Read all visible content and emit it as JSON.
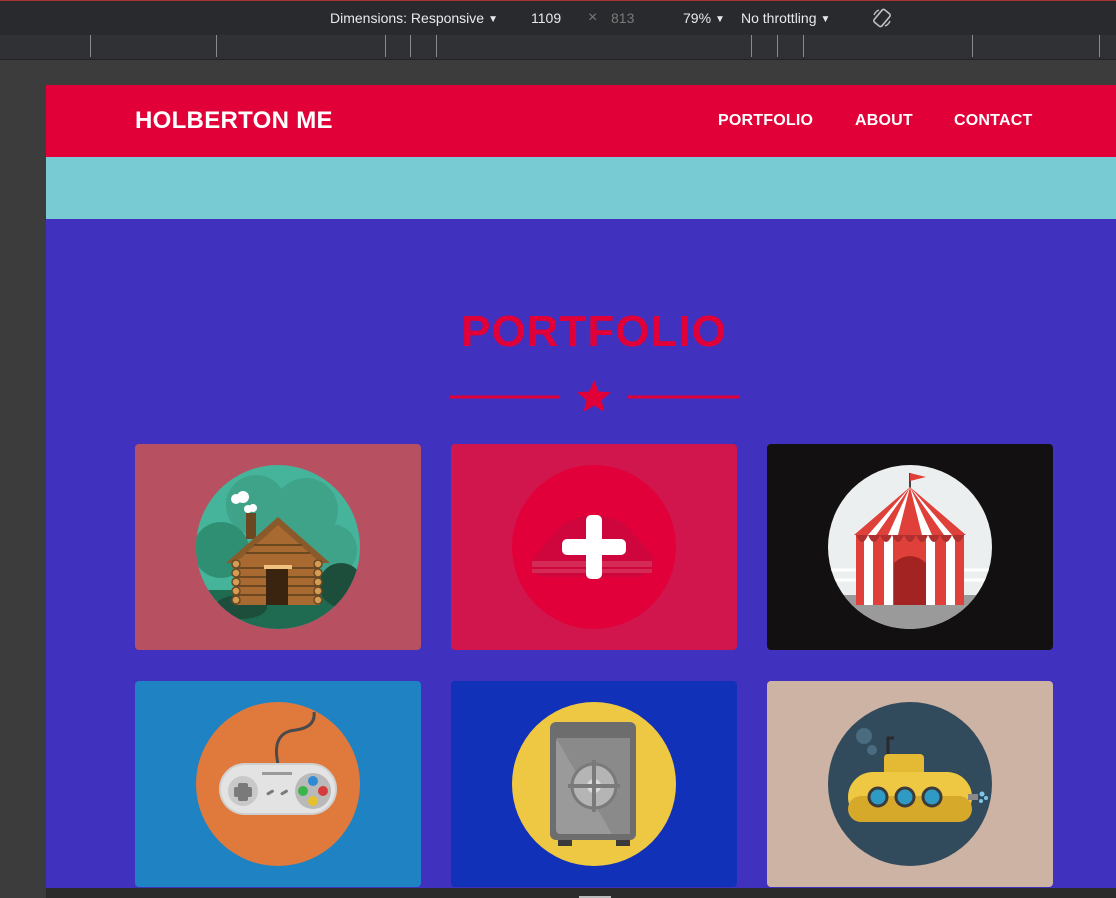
{
  "devtools": {
    "dimensions_label": "Dimensions: Responsive",
    "width_value": "1109",
    "times_symbol": "×",
    "height_value": "813",
    "zoom": "79%",
    "throttling": "No throttling",
    "rotate_icon": "rotate-icon"
  },
  "site": {
    "brand": "HOLBERTON ME",
    "nav": [
      "PORTFOLIO",
      "ABOUT",
      "CONTACT"
    ],
    "section_title": "PORTFOLIO"
  },
  "colors": {
    "header": "#e10037",
    "teal": "#78cbd2",
    "page_bg": "#4131bf",
    "accent": "#e10037"
  },
  "portfolio_items": [
    {
      "icon": "log-cabin-icon",
      "bg": "#b75161"
    },
    {
      "icon": "plus-icon",
      "bg": "#d0164d"
    },
    {
      "icon": "circus-tent-icon",
      "bg": "#131011"
    },
    {
      "icon": "gamepad-icon",
      "bg": "#1e82c3"
    },
    {
      "icon": "safe-icon",
      "bg": "#1132b8"
    },
    {
      "icon": "submarine-icon",
      "bg": "#ccb3a4"
    }
  ]
}
